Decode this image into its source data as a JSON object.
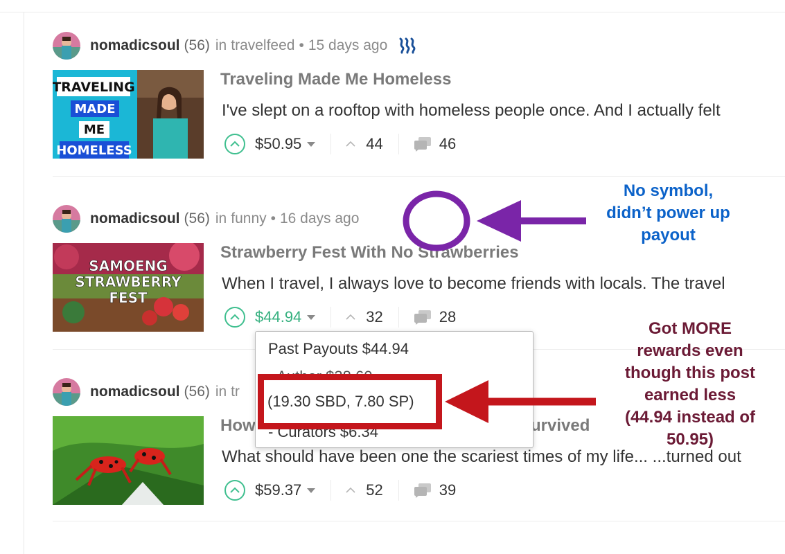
{
  "posts": [
    {
      "author": "nomadicsoul",
      "rep": "(56)",
      "in_text": "in",
      "category": "travelfeed",
      "time": "15 days ago",
      "title": "Traveling Made Me Homeless",
      "excerpt": "I've slept on a rooftop with homeless people once. And I actually felt",
      "payout": "$50.95",
      "votes": "44",
      "comments": "46",
      "thumb_lines": [
        "TRAVELING",
        "MADE",
        "ME",
        "HOMELESS"
      ],
      "has_steem_icon": true
    },
    {
      "author": "nomadicsoul",
      "rep": "(56)",
      "in_text": "in",
      "category": "funny",
      "time": "16 days ago",
      "title": "Strawberry Fest With No Strawberries",
      "excerpt": "When I travel, I always love to become friends with locals. The travel",
      "payout": "$44.94",
      "votes": "32",
      "comments": "28",
      "thumb_lines": [
        "SAMOENG",
        "STRAWBERRY",
        "FEST"
      ],
      "has_steem_icon": false
    },
    {
      "author": "nomadicsoul",
      "rep": "(56)",
      "in_text": "in tr",
      "category": "",
      "time": "",
      "title_left": "How",
      "title_right": "urvived",
      "excerpt": "What should have been one the scariest times of my life... ...turned out",
      "payout": "$59.37",
      "votes": "52",
      "comments": "39"
    }
  ],
  "dropdown": {
    "past_payouts": "Past Payouts $44.94",
    "author": "- Author $38.60",
    "breakdown": "(19.30 SBD, 7.80 SP)",
    "curators": "- Curators $6.34"
  },
  "annotations": {
    "no_symbol": [
      "No symbol,",
      "didn’t power up",
      "payout"
    ],
    "more_rewards": [
      "Got MORE",
      "rewards even",
      "though this post",
      "earned less",
      "(44.94 instead of",
      "50.95)"
    ]
  },
  "colors": {
    "accent_green": "#35b07f",
    "steem_blue": "#1a5099",
    "annotation_purple": "#7a25a8",
    "annotation_red": "#c4161c",
    "annotation_blue": "#0b62c9",
    "annotation_maroon": "#6b1a35"
  },
  "icons": [
    "avatar",
    "steem-icon",
    "upvote-icon",
    "caret-down-icon",
    "vote-count-icon",
    "comments-icon"
  ]
}
